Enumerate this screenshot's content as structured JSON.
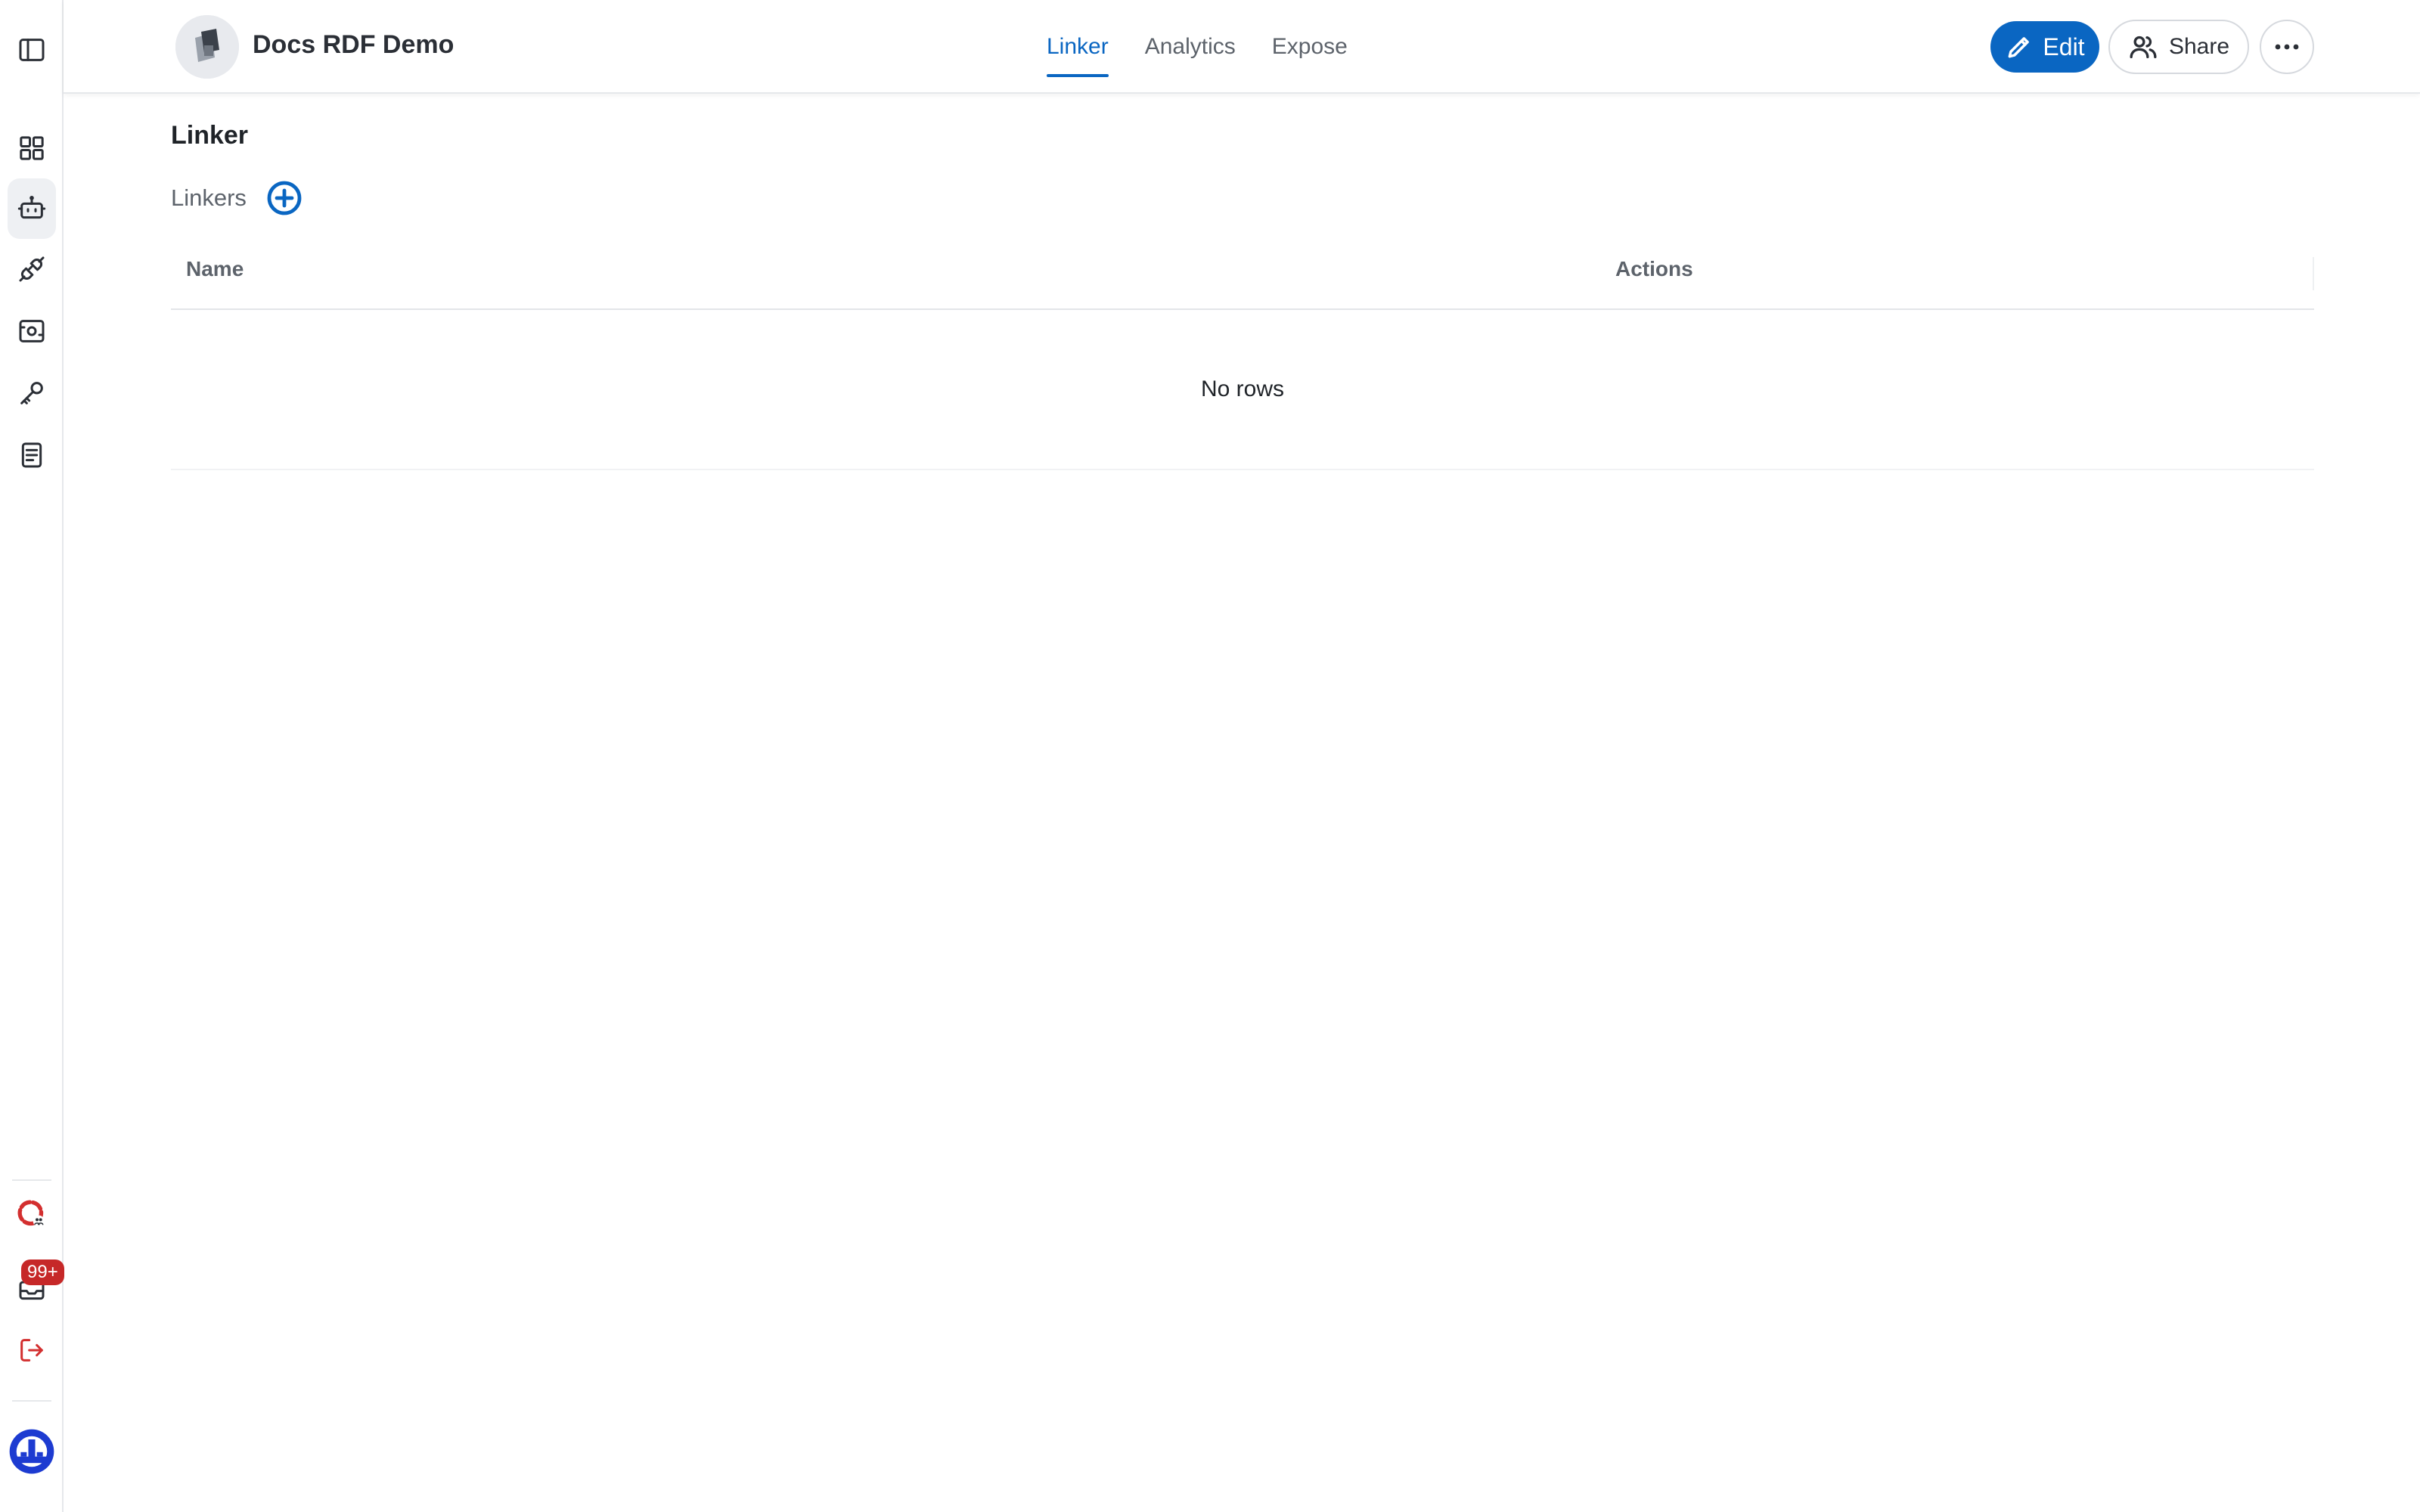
{
  "header": {
    "app_title": "Docs RDF Demo",
    "tabs": [
      {
        "label": "Linker",
        "active": true
      },
      {
        "label": "Analytics",
        "active": false
      },
      {
        "label": "Expose",
        "active": false
      }
    ],
    "edit_label": "Edit",
    "share_label": "Share"
  },
  "rail": {
    "items": [
      "sidebar-toggle-icon",
      "dashboard-icon",
      "bot-icon",
      "plug-icon",
      "scan-icon",
      "key-icon",
      "document-icon"
    ],
    "notification_count": "99+"
  },
  "main": {
    "page_title": "Linker",
    "section_label": "Linkers",
    "table": {
      "columns": [
        "Name",
        "Actions"
      ],
      "empty_text": "No rows"
    }
  },
  "colors": {
    "accent": "#0a66c2",
    "badge": "#c62828",
    "logout": "#d32f2f"
  }
}
